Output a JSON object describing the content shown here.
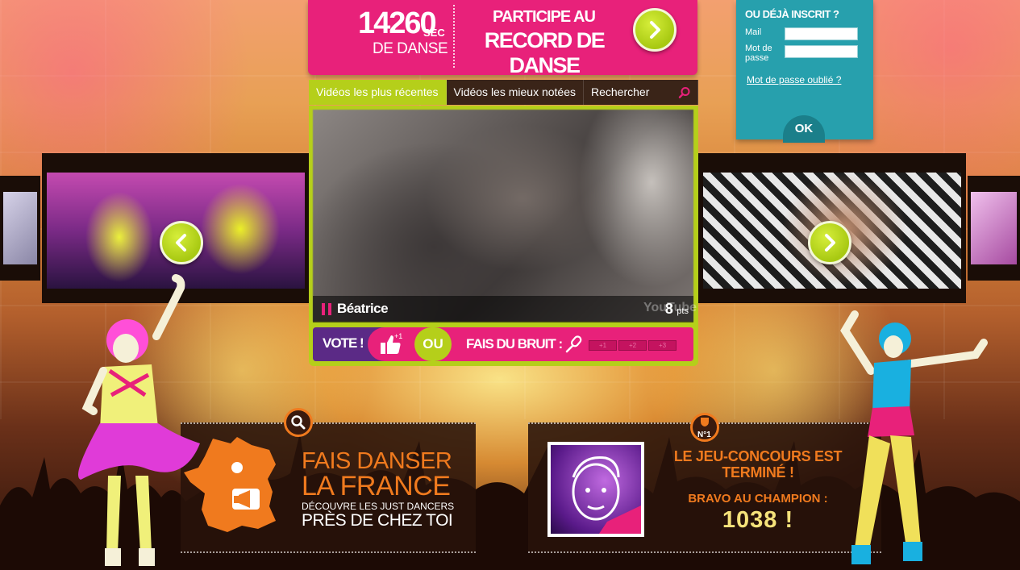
{
  "counter": {
    "number": "14260",
    "unit": "SEC",
    "label": "DE DANSE",
    "cta_line1": "PARTICIPE AU",
    "cta_line2": "RECORD DE DANSE"
  },
  "login": {
    "title": "OU DÉJÀ INSCRIT ?",
    "mail_label": "Mail",
    "password_label": "Mot de passe",
    "forgot_link": "Mot de passe oublié ?",
    "ok_button": "OK"
  },
  "tabs": [
    {
      "label": "Vidéos les plus récentes",
      "active": true
    },
    {
      "label": "Vidéos les mieux notées",
      "active": false
    },
    {
      "label": "Rechercher",
      "active": false
    }
  ],
  "player": {
    "title": "Béatrice",
    "watermark": "YouTube",
    "points": "8",
    "points_unit": "pts"
  },
  "vote": {
    "vote_label": "VOTE !",
    "vote_badge": "+1",
    "or_label": "OU",
    "noise_label": "FAIS DU",
    "noise_label2": "BRUIT :",
    "levels": [
      "+1",
      "+2",
      "+3"
    ]
  },
  "france_panel": {
    "line1": "FAIS DANSER",
    "line2": "LA FRANCE",
    "line3": "DÉCOUVRE LES JUST DANCERS",
    "line4": "PRÈS DE CHEZ TOI"
  },
  "contest_panel": {
    "badge": "N°1",
    "line1": "LE JEU-CONCOURS EST",
    "line2": "TERMINÉ !",
    "line3": "BRAVO AU CHAMPION :",
    "champion": "1038 !"
  },
  "colors": {
    "pink": "#e8217a",
    "lime": "#b5cf1a",
    "teal": "#27a0ad",
    "orange": "#f07a1e",
    "purple": "#5b2a86"
  },
  "icons": [
    "chevron-right-icon",
    "chevron-left-icon",
    "search-icon",
    "thumbs-up-icon",
    "microphone-icon",
    "pause-icon",
    "megaphone-icon",
    "trophy-icon",
    "location-pin-icon"
  ]
}
